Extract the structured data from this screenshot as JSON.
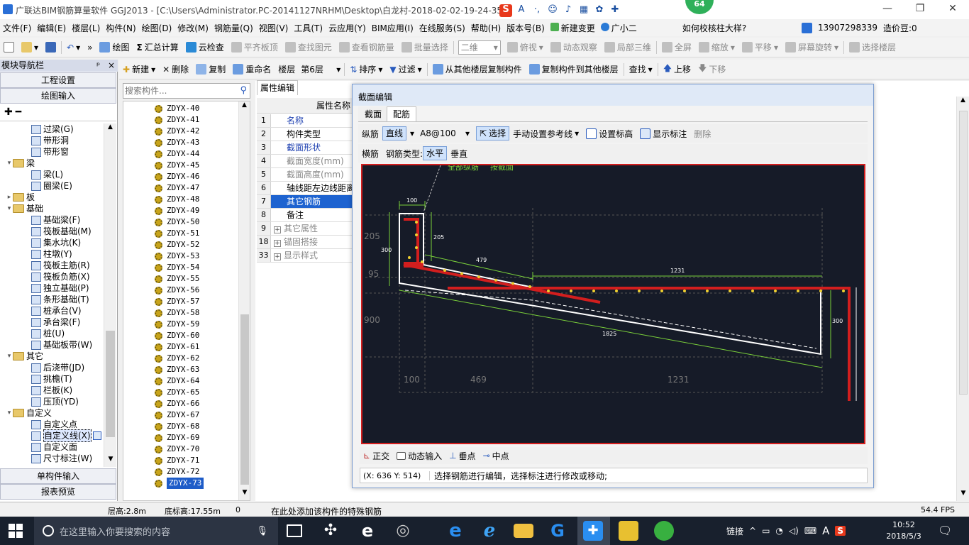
{
  "window": {
    "title": "广联达BIM钢筋算量软件 GGJ2013 - [C:\\Users\\Administrator.PC-20141127NRHM\\Desktop\\白龙村-2018-02-02-19-24-35",
    "badge": "64"
  },
  "menu": [
    "文件(F)",
    "编辑(E)",
    "楼层(L)",
    "构件(N)",
    "绘图(D)",
    "修改(M)",
    "钢筋量(Q)",
    "视图(V)",
    "工具(T)",
    "云应用(Y)",
    "BIM应用(I)",
    "在线服务(S)",
    "帮助(H)",
    "版本号(B)",
    "新建变更",
    "广小二"
  ],
  "menu_right": {
    "question": "如何校核柱大样?",
    "phone": "13907298339",
    "price": "造价豆:0"
  },
  "toolbar1": {
    "draw": "绘图",
    "sum": "汇总计算",
    "cloud_check": "云检查",
    "flat": "平齐板顶",
    "find": "查找图元",
    "view_qty": "查看钢筋量",
    "batch": "批量选择",
    "view_mode": "二维",
    "top_view": "俯视",
    "dyn": "动态观察",
    "local3d": "局部三维",
    "full": "全屏",
    "zoom": "缩放",
    "pan": "平移",
    "rotate": "屏幕旋转",
    "select_floor": "选择楼层"
  },
  "toolbar2": {
    "new": "新建",
    "delete": "删除",
    "copy": "复制",
    "rename": "重命名",
    "floor_label": "楼层",
    "floor": "第6层",
    "sort": "排序",
    "filter": "过滤",
    "copy_from": "从其他楼层复制构件",
    "copy_to": "复制构件到其他楼层",
    "find": "查找",
    "up": "上移",
    "down": "下移"
  },
  "nav": {
    "header": "模块导航栏",
    "project": "工程设置",
    "drawing": "绘图输入",
    "single": "单构件输入",
    "report": "报表预览",
    "tree": [
      {
        "label": "过梁(G)",
        "level": 2
      },
      {
        "label": "带形洞",
        "level": 2
      },
      {
        "label": "带形窗",
        "level": 2
      },
      {
        "label": "梁",
        "level": 1,
        "open": true
      },
      {
        "label": "梁(L)",
        "level": 2
      },
      {
        "label": "圈梁(E)",
        "level": 2
      },
      {
        "label": "板",
        "level": 1,
        "open": false
      },
      {
        "label": "基础",
        "level": 1,
        "open": true
      },
      {
        "label": "基础梁(F)",
        "level": 2
      },
      {
        "label": "筏板基础(M)",
        "level": 2
      },
      {
        "label": "集水坑(K)",
        "level": 2
      },
      {
        "label": "柱墩(Y)",
        "level": 2
      },
      {
        "label": "筏板主筋(R)",
        "level": 2
      },
      {
        "label": "筏板负筋(X)",
        "level": 2
      },
      {
        "label": "独立基础(P)",
        "level": 2
      },
      {
        "label": "条形基础(T)",
        "level": 2
      },
      {
        "label": "桩承台(V)",
        "level": 2
      },
      {
        "label": "承台梁(F)",
        "level": 2
      },
      {
        "label": "桩(U)",
        "level": 2
      },
      {
        "label": "基础板带(W)",
        "level": 2
      },
      {
        "label": "其它",
        "level": 1,
        "open": true
      },
      {
        "label": "后浇带(JD)",
        "level": 2
      },
      {
        "label": "挑檐(T)",
        "level": 2
      },
      {
        "label": "栏板(K)",
        "level": 2
      },
      {
        "label": "压顶(YD)",
        "level": 2
      },
      {
        "label": "自定义",
        "level": 1,
        "open": true
      },
      {
        "label": "自定义点",
        "level": 2
      },
      {
        "label": "自定义线(X)",
        "level": 2,
        "selected": true
      },
      {
        "label": "自定义面",
        "level": 2
      },
      {
        "label": "尺寸标注(W)",
        "level": 2
      }
    ]
  },
  "search": {
    "placeholder": "搜索构件..."
  },
  "components": [
    "ZDYX-40",
    "ZDYX-41",
    "ZDYX-42",
    "ZDYX-43",
    "ZDYX-44",
    "ZDYX-45",
    "ZDYX-46",
    "ZDYX-47",
    "ZDYX-48",
    "ZDYX-49",
    "ZDYX-50",
    "ZDYX-51",
    "ZDYX-52",
    "ZDYX-53",
    "ZDYX-54",
    "ZDYX-55",
    "ZDYX-56",
    "ZDYX-57",
    "ZDYX-58",
    "ZDYX-59",
    "ZDYX-60",
    "ZDYX-61",
    "ZDYX-62",
    "ZDYX-63",
    "ZDYX-64",
    "ZDYX-65",
    "ZDYX-66",
    "ZDYX-67",
    "ZDYX-68",
    "ZDYX-69",
    "ZDYX-70",
    "ZDYX-71",
    "ZDYX-72",
    "ZDYX-73"
  ],
  "selected_component": "ZDYX-73",
  "props": {
    "tab": "属性编辑",
    "header": "属性名称",
    "rows": [
      {
        "num": "1",
        "name": "名称",
        "style": "blue"
      },
      {
        "num": "2",
        "name": "构件类型",
        "style": ""
      },
      {
        "num": "3",
        "name": "截面形状",
        "style": "blue"
      },
      {
        "num": "4",
        "name": "截面宽度(mm)",
        "style": "gray"
      },
      {
        "num": "5",
        "name": "截面高度(mm)",
        "style": "gray"
      },
      {
        "num": "6",
        "name": "轴线距左边线距离",
        "style": ""
      },
      {
        "num": "7",
        "name": "其它钢筋",
        "style": "sel"
      },
      {
        "num": "8",
        "name": "备注",
        "style": ""
      },
      {
        "num": "9",
        "name": "其它属性",
        "style": "gray",
        "plus": true
      },
      {
        "num": "18",
        "name": "锚固搭接",
        "style": "gray",
        "plus": true
      },
      {
        "num": "33",
        "name": "显示样式",
        "style": "gray",
        "plus": true
      }
    ]
  },
  "dialog": {
    "title": "截面编辑",
    "tab_section": "截面",
    "tab_rebar": "配筋",
    "long_rebar": "纵筋",
    "line": "直线",
    "spec": "A8@100",
    "select": "选择",
    "manual_ref": "手动设置参考线",
    "set_elev": "设置标高",
    "show_label": "显示标注",
    "del": "删除",
    "trans_rebar": "横筋",
    "rebar_type": "钢筋类型:",
    "horizontal": "水平",
    "vertical": "垂直",
    "ortho": "正交",
    "dyn_input": "动态输入",
    "perp": "垂点",
    "mid": "中点",
    "coord": "(X: 636 Y: 514)",
    "hint": "选择钢筋进行编辑，选择标注进行修改或移动;",
    "drawing_labels": {
      "top": "全部纵筋",
      "top2": "按截面",
      "d100": "100",
      "d205a": "205",
      "d205b": "205",
      "d479": "479",
      "d1231a": "1231",
      "d95": "95",
      "d300a": "300",
      "d300b": "300",
      "d900": "900",
      "d1825": "1825",
      "b100": "100",
      "b469": "469",
      "b1231": "1231"
    }
  },
  "status": {
    "floor_h": "层高:2.8m",
    "base_h": "底标高:17.55m",
    "zero": "0",
    "msg": "在此处添加该构件的特殊钢筋",
    "fps": "54.4 FPS"
  },
  "taskbar": {
    "search": "在这里输入你要搜索的内容",
    "link": "链接",
    "ime": "A",
    "time": "10:52",
    "date": "2018/5/3"
  }
}
